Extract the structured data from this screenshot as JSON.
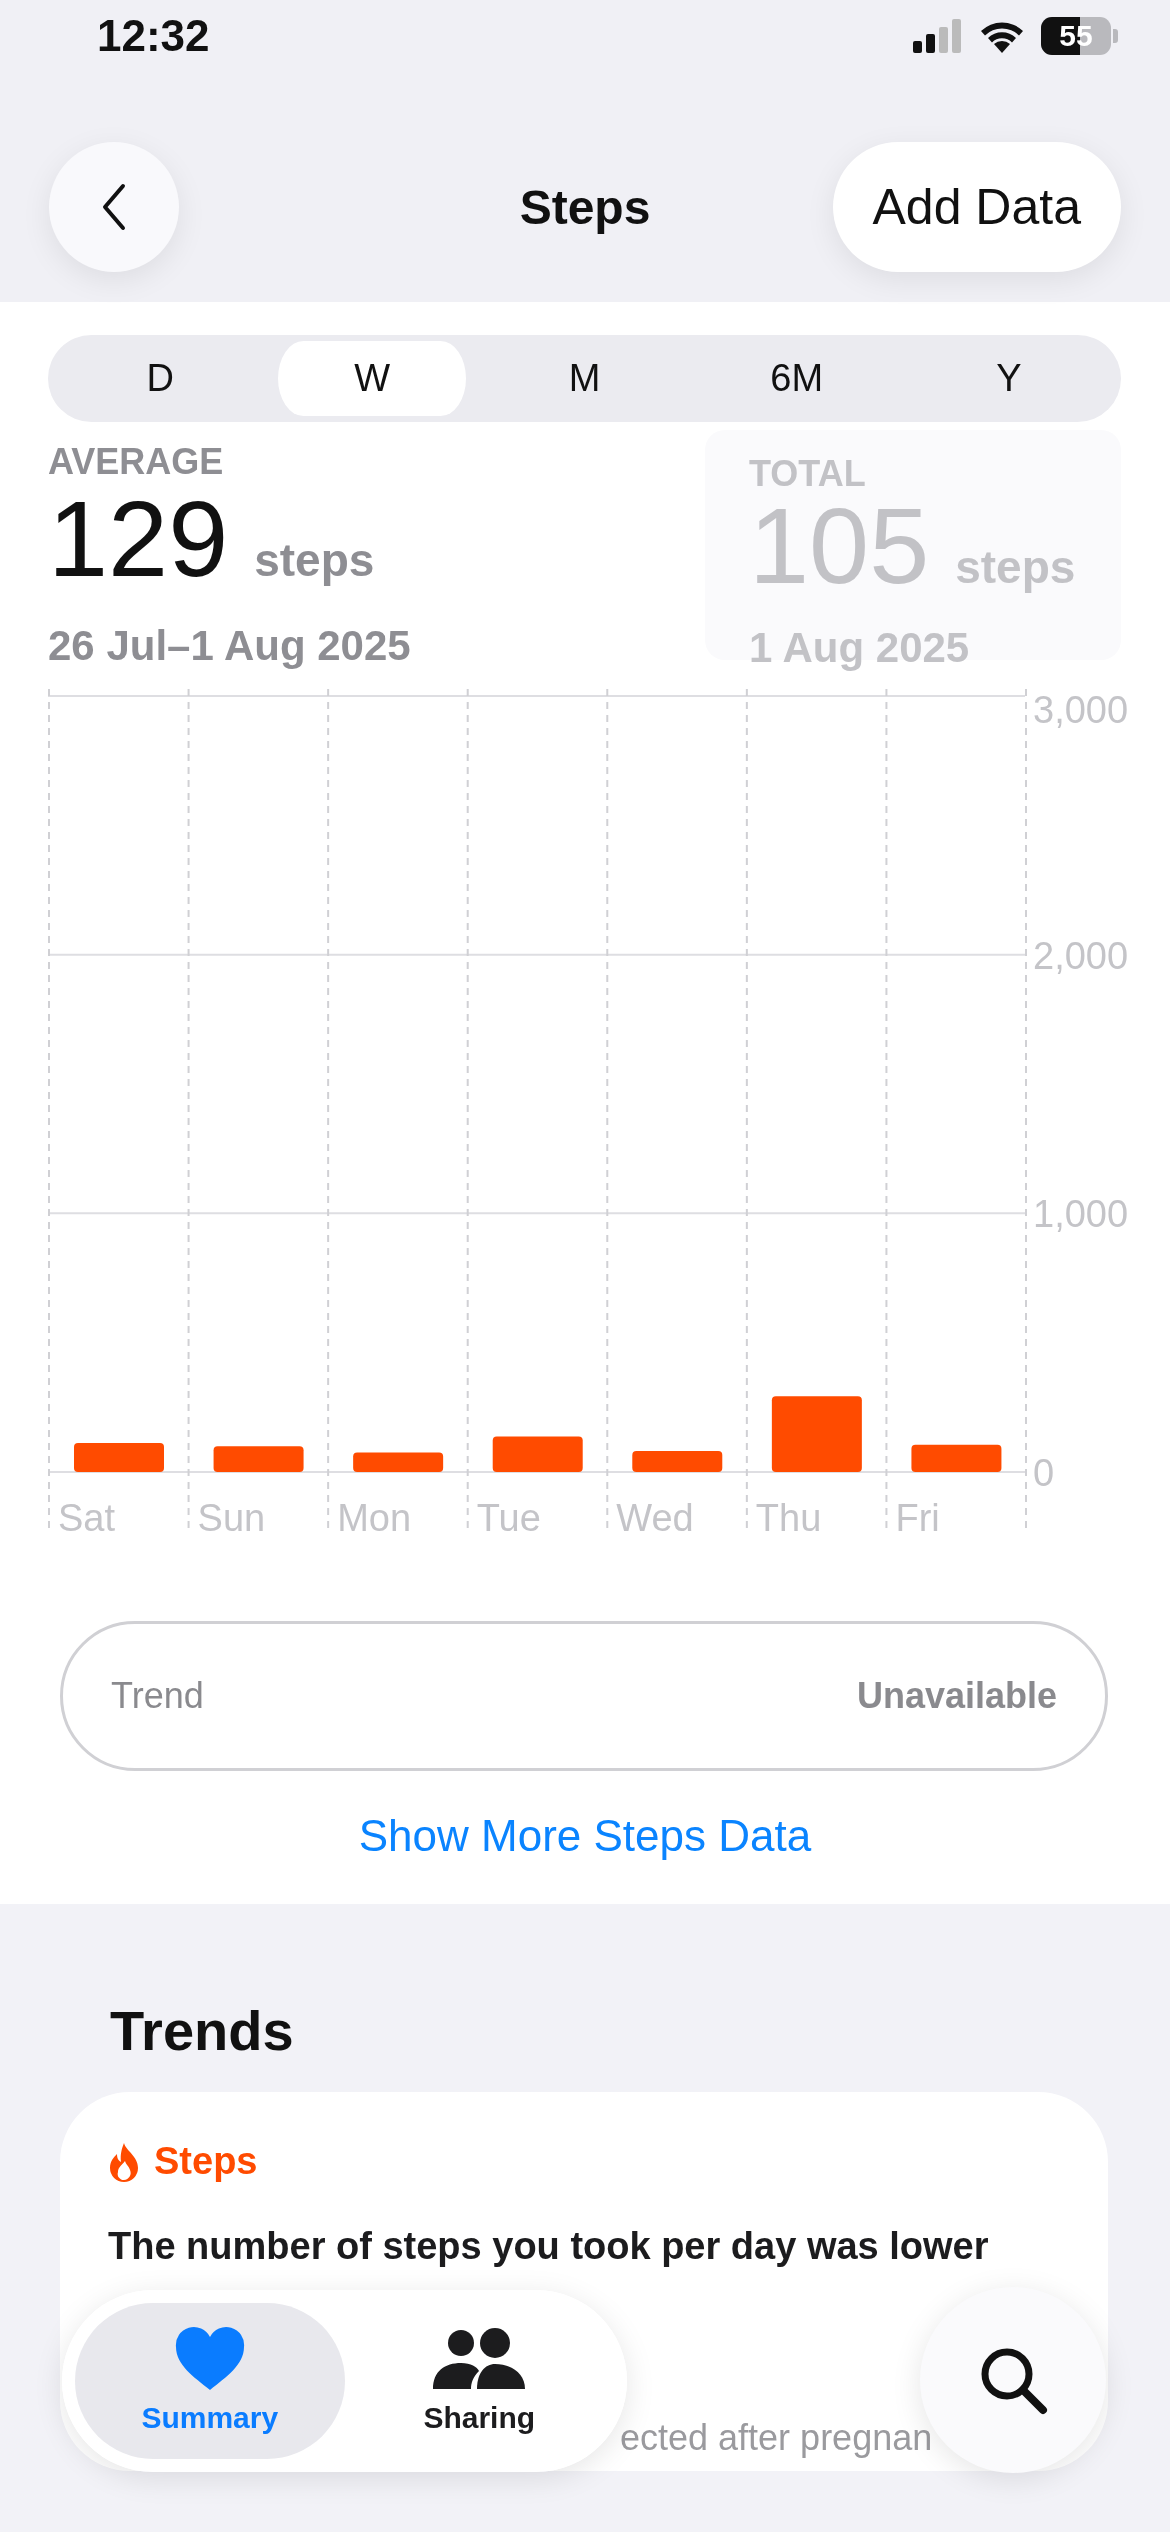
{
  "status_bar": {
    "time": "12:32",
    "battery": "55"
  },
  "nav": {
    "title": "Steps",
    "action": "Add Data"
  },
  "ranges": [
    {
      "label": "D",
      "selected": false
    },
    {
      "label": "W",
      "selected": true
    },
    {
      "label": "M",
      "selected": false
    },
    {
      "label": "6M",
      "selected": false
    },
    {
      "label": "Y",
      "selected": false
    }
  ],
  "summary": {
    "label": "AVERAGE",
    "value": "129",
    "unit": "steps",
    "date": "26 Jul–1 Aug 2025"
  },
  "selection": {
    "label": "TOTAL",
    "value": "105",
    "unit": "steps",
    "date": "1 Aug 2025"
  },
  "chart_data": {
    "type": "bar",
    "categories": [
      "Sat",
      "Sun",
      "Mon",
      "Tue",
      "Wed",
      "Thu",
      "Fri"
    ],
    "values": [
      112,
      100,
      75,
      137,
      81,
      293,
      105
    ],
    "ylim": [
      0,
      3000
    ],
    "yticks": [
      {
        "value": 0,
        "label": "0"
      },
      {
        "value": 1000,
        "label": "1,000"
      },
      {
        "value": 2000,
        "label": "2,000"
      },
      {
        "value": 3000,
        "label": "3,000"
      }
    ]
  },
  "trend": {
    "label": "Trend",
    "value": "Unavailable"
  },
  "more_link": "Show More Steps Data",
  "trends": {
    "title": "Trends",
    "card": {
      "category": "Steps",
      "text": "The number of steps you took per day was lower",
      "note": "ected after pregnan"
    }
  },
  "tab_bar": {
    "tabs": [
      {
        "label": "Summary",
        "selected": true,
        "kind": "summary"
      },
      {
        "label": "Sharing",
        "selected": false,
        "kind": "sharing"
      }
    ]
  }
}
